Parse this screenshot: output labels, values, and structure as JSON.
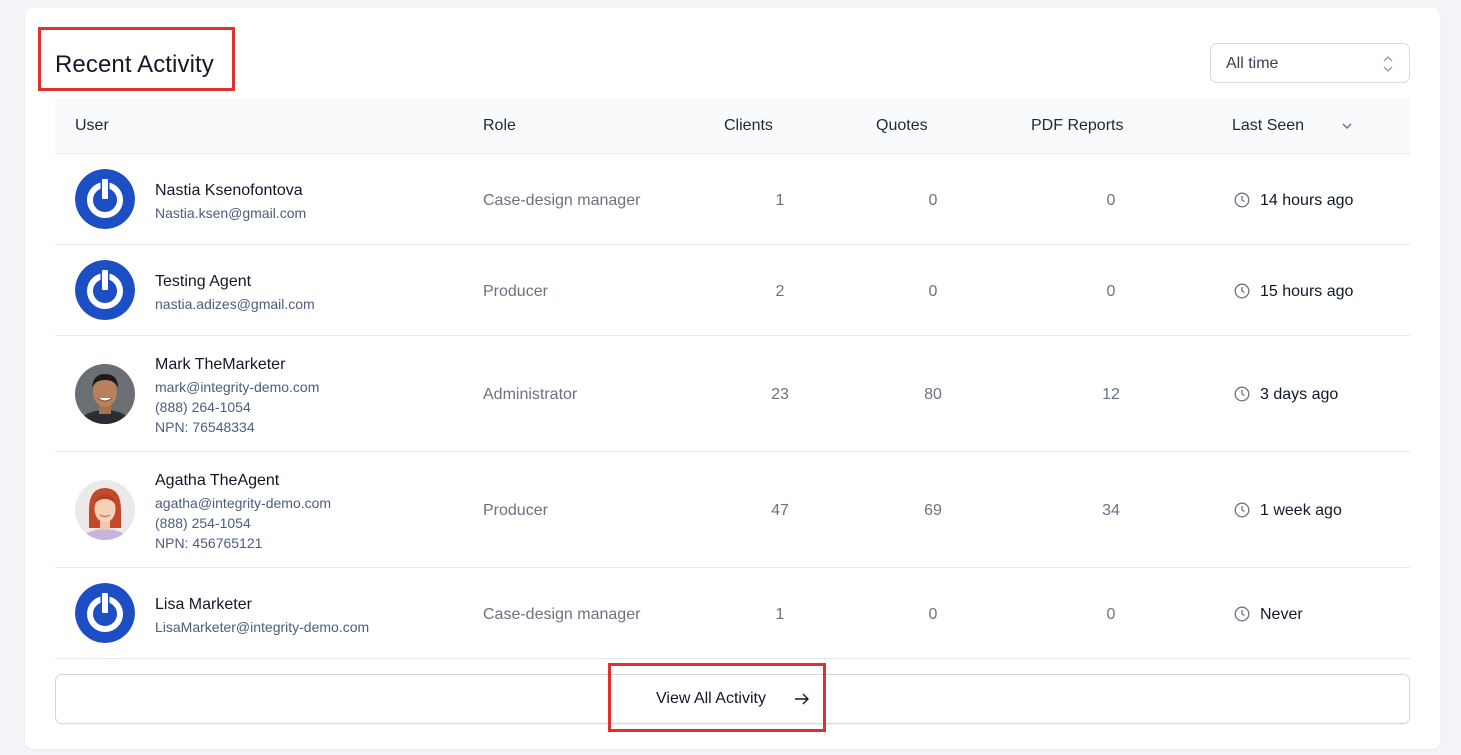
{
  "header": {
    "title": "Recent Activity"
  },
  "filter": {
    "selected": "All time"
  },
  "table": {
    "columns": {
      "user": "User",
      "role": "Role",
      "clients": "Clients",
      "quotes": "Quotes",
      "pdf": "PDF Reports",
      "last_seen": "Last Seen"
    },
    "rows": [
      {
        "name": "Nastia Ksenofontova",
        "email": "Nastia.ksen@gmail.com",
        "role": "Case-design manager",
        "clients": "1",
        "quotes": "0",
        "pdf": "0",
        "last_seen": "14 hours ago",
        "avatar": "power-logo-avatar"
      },
      {
        "name": "Testing Agent",
        "email": "nastia.adizes@gmail.com",
        "role": "Producer",
        "clients": "2",
        "quotes": "0",
        "pdf": "0",
        "last_seen": "15 hours ago",
        "avatar": "power-logo-avatar"
      },
      {
        "name": "Mark TheMarketer",
        "email": "mark@integrity-demo.com",
        "phone": "(888) 264-1054",
        "npn": "NPN: 76548334",
        "role": "Administrator",
        "clients": "23",
        "quotes": "80",
        "pdf": "12",
        "last_seen": "3 days ago",
        "avatar": "photo-avatar"
      },
      {
        "name": "Agatha TheAgent",
        "email": "agatha@integrity-demo.com",
        "phone": "(888) 254-1054",
        "npn": "NPN: 456765121",
        "role": "Producer",
        "clients": "47",
        "quotes": "69",
        "pdf": "34",
        "last_seen": "1 week ago",
        "avatar": "photo-avatar"
      },
      {
        "name": "Lisa Marketer",
        "email": "LisaMarketer@integrity-demo.com",
        "role": "Case-design manager",
        "clients": "1",
        "quotes": "0",
        "pdf": "0",
        "last_seen": "Never",
        "avatar": "power-logo-avatar"
      }
    ]
  },
  "footer": {
    "view_all_label": "View All Activity"
  },
  "colors": {
    "brand_blue": "#1d4fc4",
    "highlight_red": "#e03131",
    "muted_text": "#6b7280"
  }
}
